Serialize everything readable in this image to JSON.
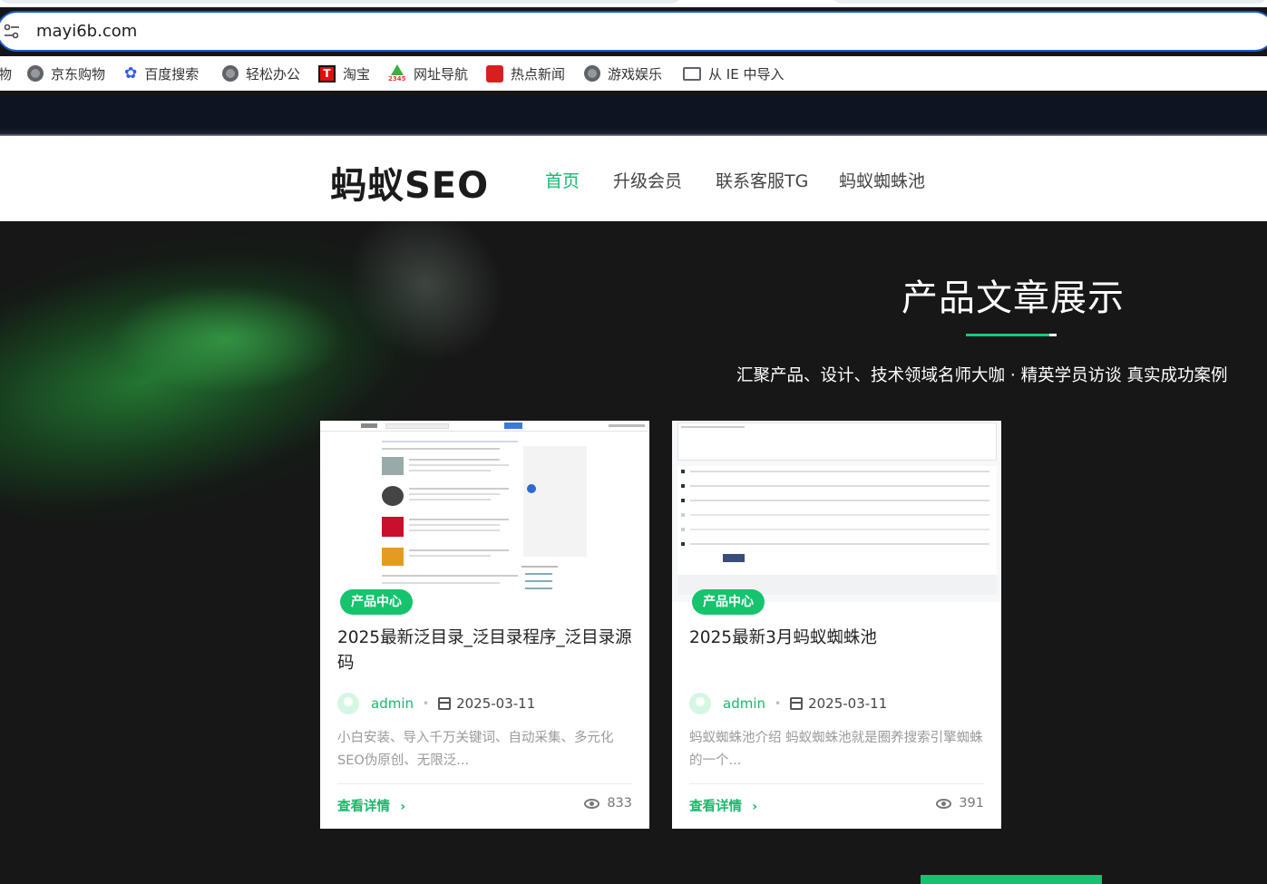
{
  "browser": {
    "url": "mayi6b.com",
    "bookmarks": [
      {
        "label": "物",
        "icon": "bookmark-icon"
      },
      {
        "label": "京东购物",
        "icon": "globe-icon"
      },
      {
        "label": "百度搜索",
        "icon": "baidu-paw-icon"
      },
      {
        "label": "轻松办公",
        "icon": "globe-icon"
      },
      {
        "label": "淘宝",
        "icon": "taobao-icon"
      },
      {
        "label": "网址导航",
        "icon": "2345-nav-icon"
      },
      {
        "label": "热点新闻",
        "icon": "news-icon"
      },
      {
        "label": "游戏娱乐",
        "icon": "globe-icon"
      },
      {
        "label": "从 IE 中导入",
        "icon": "folder-icon"
      }
    ]
  },
  "site": {
    "logo": "蚂蚁SEO",
    "nav": [
      "首页",
      "升级会员",
      "联系客服TG",
      "蚂蚁蜘蛛池"
    ],
    "accent": "#15c46d"
  },
  "hero": {
    "title": "产品文章展示",
    "subtitle": "汇聚产品、设计、技术领域名师大咖 · 精英学员访谈 真实成功案例"
  },
  "cards": [
    {
      "badge": "产品中心",
      "title": "2025最新泛目录_泛目录程序_泛目录源码",
      "author": "admin",
      "date": "2025-03-11",
      "excerpt": "小白安装、导入千万关键词、自动采集、多元化SEO伪原创、无限泛...",
      "more": "查看详情",
      "views": "833"
    },
    {
      "badge": "产品中心",
      "title": "2025最新3月蚂蚁蜘蛛池",
      "author": "admin",
      "date": "2025-03-11",
      "excerpt": "蚂蚁蜘蛛池介绍 蚂蚁蜘蛛池就是圈养搜索引擎蜘蛛的一个...",
      "more": "查看详情",
      "views": "391"
    }
  ]
}
